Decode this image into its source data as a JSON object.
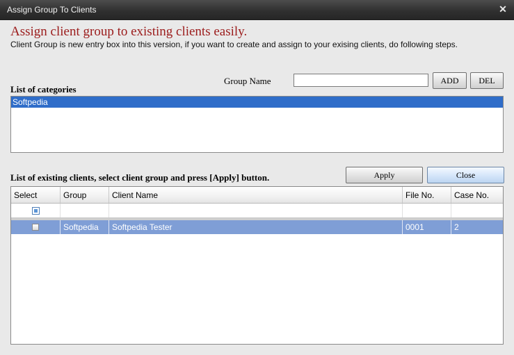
{
  "window": {
    "title": "Assign Group To Clients",
    "close_glyph": "✕"
  },
  "header": {
    "headline": "Assign client group to existing clients easily.",
    "description": "Client Group is new entry box into this version, if you want to create and assign to your exising clients, do following steps."
  },
  "group_form": {
    "label": "Group Name",
    "value": "",
    "add_label": "ADD",
    "del_label": "DEL"
  },
  "categories": {
    "label": "List of categories",
    "items": [
      {
        "label": "Softpedia",
        "selected": true
      }
    ]
  },
  "clients": {
    "label": "List of existing clients, select client group and press [Apply] button.",
    "apply_label": "Apply",
    "close_label": "Close",
    "columns": [
      "Select",
      "Group",
      "Client Name",
      "File No.",
      "Case No."
    ],
    "rows": [
      {
        "group": "Softpedia",
        "client_name": "Softpedia Tester",
        "file_no": "0001",
        "case_no": "2",
        "selected": true
      }
    ]
  },
  "colors": {
    "headline": "#9b1b1b",
    "selection": "#2f6dc9",
    "grid_row_highlight": "#7f9ed6"
  }
}
